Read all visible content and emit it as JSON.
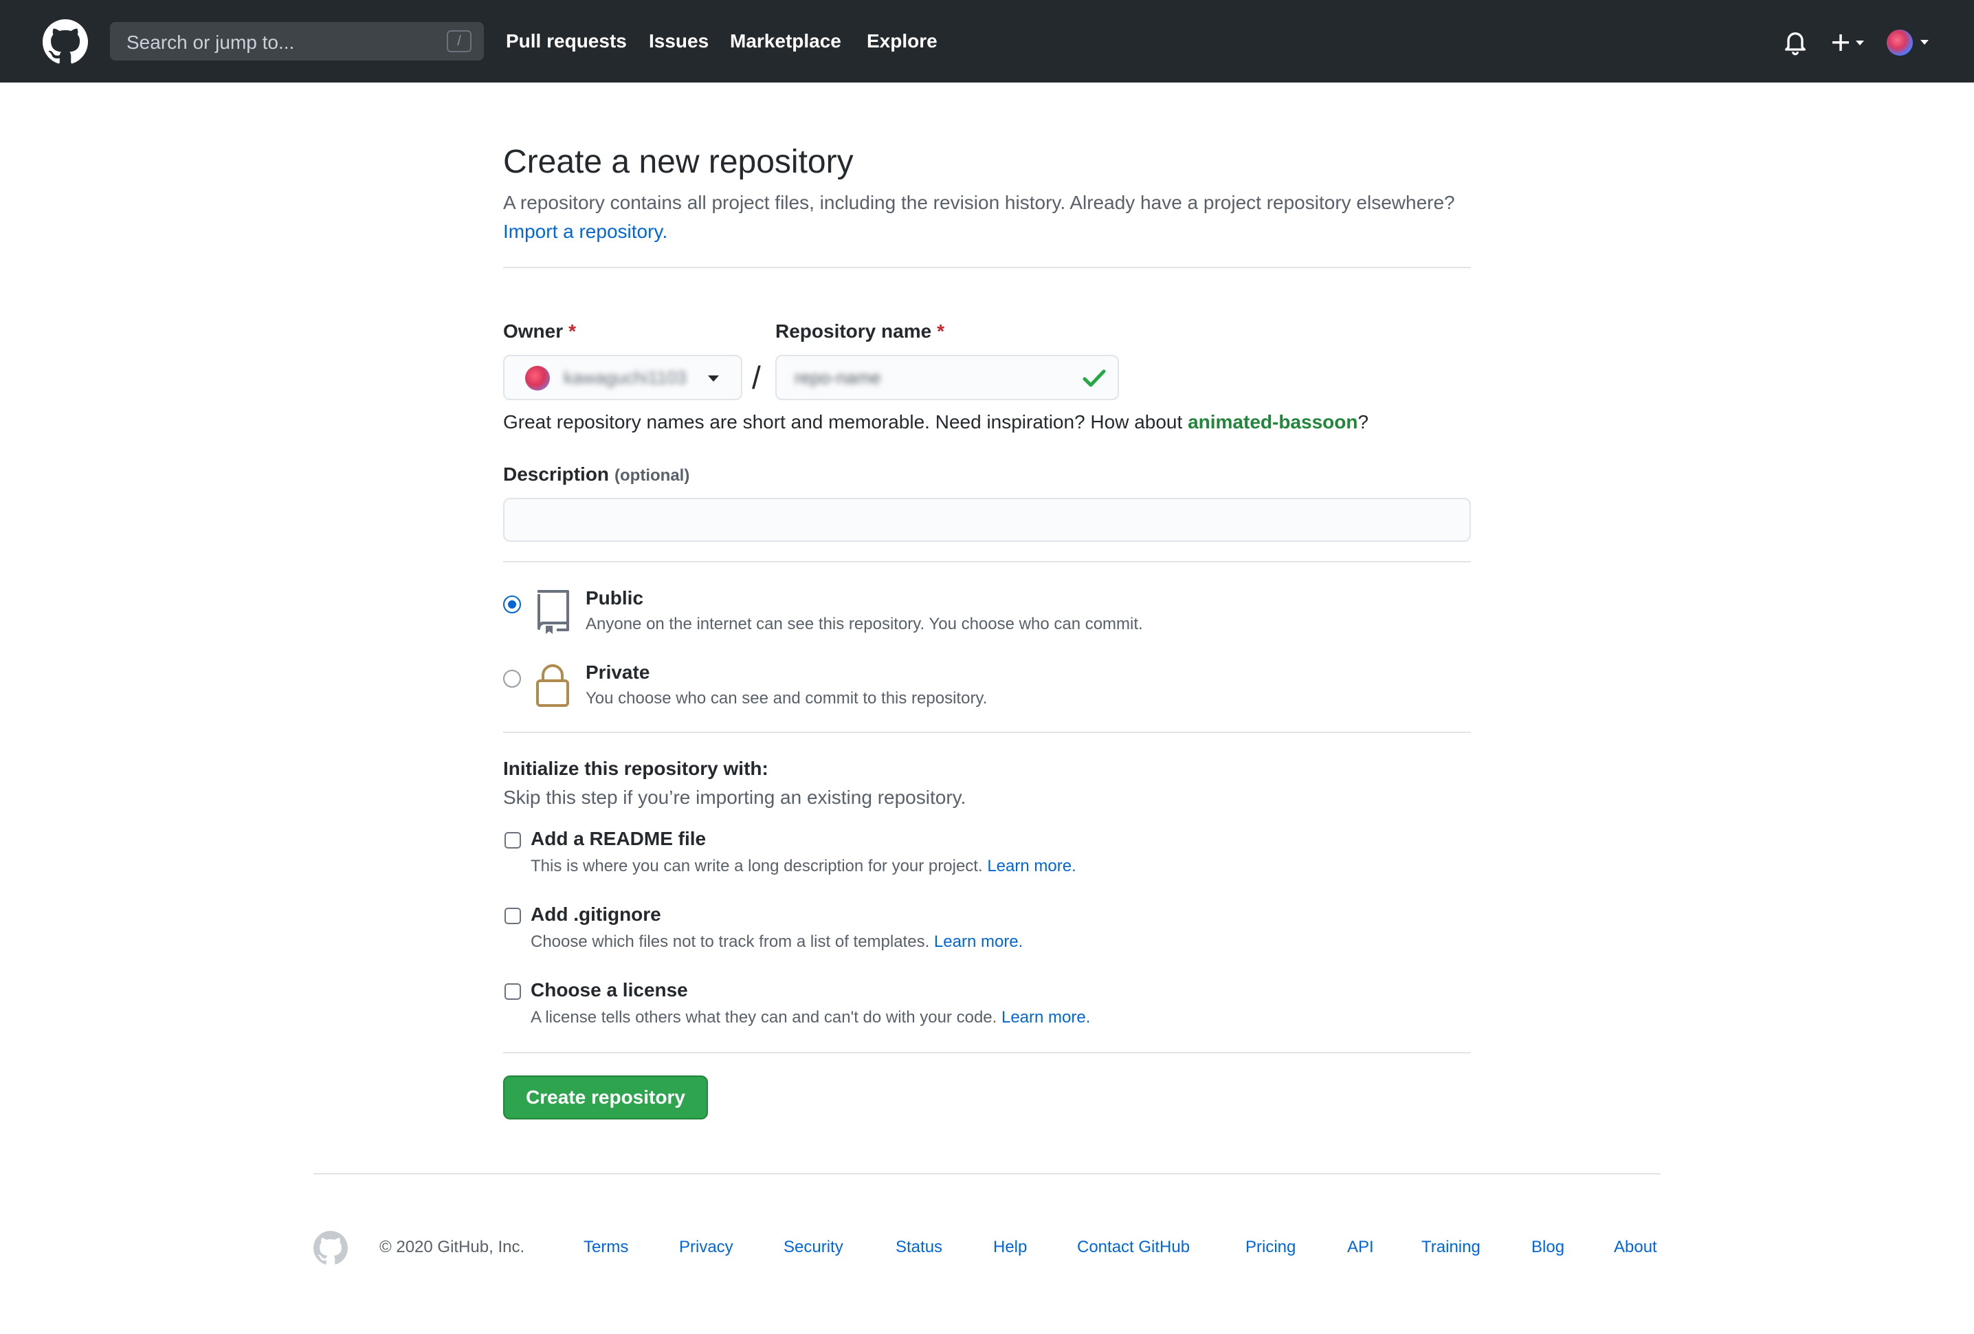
{
  "header": {
    "search_placeholder": "Search or jump to...",
    "slash_key": "/",
    "nav": [
      {
        "label": "Pull requests"
      },
      {
        "label": "Issues"
      },
      {
        "label": "Marketplace"
      },
      {
        "label": "Explore"
      }
    ]
  },
  "page": {
    "title": "Create a new repository",
    "intro": "A repository contains all project files, including the revision history. Already have a project repository elsewhere?",
    "import_link": "Import a repository."
  },
  "form": {
    "owner_label": "Owner",
    "repo_label": "Repository name",
    "required_mark": "*",
    "owner_value": "kawaguchi1103",
    "slash": "/",
    "repo_value": "repo-name",
    "name_hint_prefix": "Great repository names are short and memorable. Need inspiration? How about",
    "name_suggestion": "animated-bassoon",
    "name_hint_suffix": "?",
    "description_label": "Description",
    "description_optional": "(optional)",
    "description_value": "",
    "visibility": [
      {
        "title": "Public",
        "description": "Anyone on the internet can see this repository. You choose who can commit.",
        "selected": true
      },
      {
        "title": "Private",
        "description": "You choose who can see and commit to this repository.",
        "selected": false
      }
    ],
    "init_title": "Initialize this repository with:",
    "init_subtitle": "Skip this step if you’re importing an existing repository.",
    "init_options": [
      {
        "title": "Add a README file",
        "description": "This is where you can write a long description for your project.",
        "link": "Learn more.",
        "checked": false
      },
      {
        "title": "Add .gitignore",
        "description": "Choose which files not to track from a list of templates.",
        "link": "Learn more.",
        "checked": false
      },
      {
        "title": "Choose a license",
        "description": "A license tells others what they can and can't do with your code.",
        "link": "Learn more.",
        "checked": false
      }
    ],
    "submit_label": "Create repository"
  },
  "footer": {
    "copyright": "© 2020 GitHub, Inc.",
    "links": [
      {
        "label": "Terms"
      },
      {
        "label": "Privacy"
      },
      {
        "label": "Security"
      },
      {
        "label": "Status"
      },
      {
        "label": "Help"
      },
      {
        "label": "Contact GitHub"
      },
      {
        "label": "Pricing"
      },
      {
        "label": "API"
      },
      {
        "label": "Training"
      },
      {
        "label": "Blog"
      },
      {
        "label": "About"
      }
    ]
  },
  "colors": {
    "header_bg": "#24292e",
    "link": "#0366d6",
    "success": "#2ea44f",
    "required": "#cb2431",
    "suggestion": "#22863a"
  }
}
